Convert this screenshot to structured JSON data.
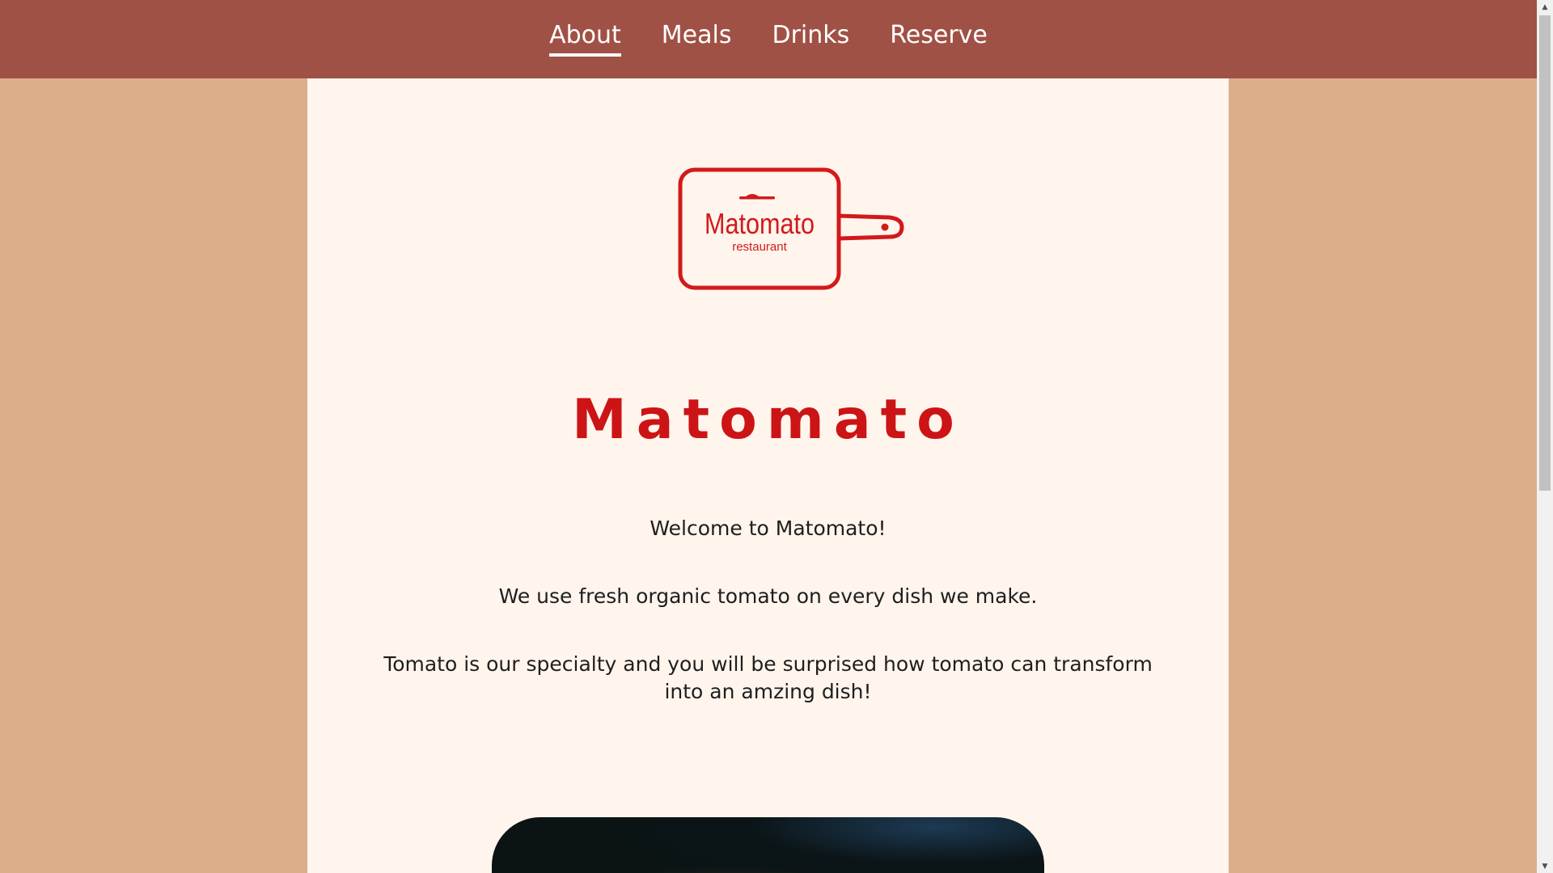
{
  "nav": {
    "items": [
      {
        "label": "About",
        "active": true
      },
      {
        "label": "Meals",
        "active": false
      },
      {
        "label": "Drinks",
        "active": false
      },
      {
        "label": "Reserve",
        "active": false
      }
    ]
  },
  "logo": {
    "brand": "Matomato",
    "subtitle": "restaurant",
    "icon": "cutting-board-icon",
    "color": "#d2191c"
  },
  "main": {
    "title": "Matomato",
    "paragraphs": [
      "Welcome to Matomato!",
      "We use fresh organic tomato on every dish we make.",
      "Tomato is our specialty and you will be surprised how tomato can transform into an amzing dish!"
    ]
  },
  "colors": {
    "nav_bg": "#a05145",
    "page_bg": "#ddae8a",
    "content_bg": "#fff5ec",
    "title": "#cc1416"
  }
}
